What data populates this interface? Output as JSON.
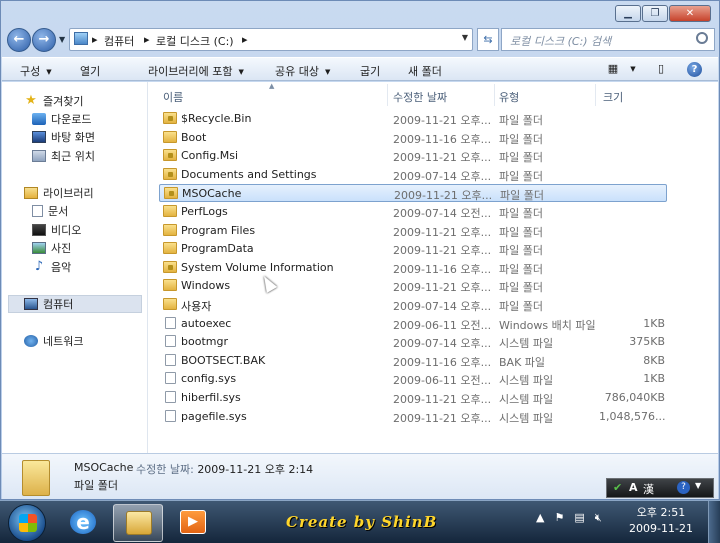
{
  "address": {
    "crumbs": [
      "컴퓨터",
      "로컬 디스크 (C:)"
    ],
    "search_placeholder": "로컬 디스크 (C:) 검색"
  },
  "toolbar": {
    "organize": "구성",
    "open": "열기",
    "include_library": "라이브러리에 포함",
    "share_with": "공유 대상",
    "burn": "굽기",
    "new_folder": "새 폴더"
  },
  "sidebar": {
    "favorites": "즐겨찾기",
    "downloads": "다운로드",
    "desktop": "바탕 화면",
    "recent": "최근 위치",
    "libraries": "라이브러리",
    "documents": "문서",
    "videos": "비디오",
    "pictures": "사진",
    "music": "음악",
    "computer": "컴퓨터",
    "network": "네트워크"
  },
  "columns": {
    "name": "이름",
    "date": "수정한 날짜",
    "type": "유형",
    "size": "크기"
  },
  "files": [
    {
      "name": "$Recycle.Bin",
      "date": "2009-11-21 오후...",
      "type": "파일 폴더",
      "size": "",
      "icon": "locked-folder-icon"
    },
    {
      "name": "Boot",
      "date": "2009-11-16 오후...",
      "type": "파일 폴더",
      "size": "",
      "icon": "folder-icon"
    },
    {
      "name": "Config.Msi",
      "date": "2009-11-21 오후...",
      "type": "파일 폴더",
      "size": "",
      "icon": "locked-folder-icon"
    },
    {
      "name": "Documents and Settings",
      "date": "2009-07-14 오후...",
      "type": "파일 폴더",
      "size": "",
      "icon": "locked-folder-icon"
    },
    {
      "name": "MSOCache",
      "date": "2009-11-21 오후...",
      "type": "파일 폴더",
      "size": "",
      "icon": "locked-folder-icon"
    },
    {
      "name": "PerfLogs",
      "date": "2009-07-14 오전...",
      "type": "파일 폴더",
      "size": "",
      "icon": "folder-icon"
    },
    {
      "name": "Program Files",
      "date": "2009-11-21 오후...",
      "type": "파일 폴더",
      "size": "",
      "icon": "folder-icon"
    },
    {
      "name": "ProgramData",
      "date": "2009-11-21 오후...",
      "type": "파일 폴더",
      "size": "",
      "icon": "folder-icon"
    },
    {
      "name": "System Volume Information",
      "date": "2009-11-16 오후...",
      "type": "파일 폴더",
      "size": "",
      "icon": "locked-folder-icon"
    },
    {
      "name": "Windows",
      "date": "2009-11-21 오후...",
      "type": "파일 폴더",
      "size": "",
      "icon": "folder-icon"
    },
    {
      "name": "사용자",
      "date": "2009-07-14 오후...",
      "type": "파일 폴더",
      "size": "",
      "icon": "folder-icon"
    },
    {
      "name": "autoexec",
      "date": "2009-06-11 오전...",
      "type": "Windows 배치 파일",
      "size": "1KB",
      "icon": "file-icon"
    },
    {
      "name": "bootmgr",
      "date": "2009-07-14 오후...",
      "type": "시스템 파일",
      "size": "375KB",
      "icon": "file-icon"
    },
    {
      "name": "BOOTSECT.BAK",
      "date": "2009-11-16 오후...",
      "type": "BAK 파일",
      "size": "8KB",
      "icon": "file-icon"
    },
    {
      "name": "config.sys",
      "date": "2009-06-11 오전...",
      "type": "시스템 파일",
      "size": "1KB",
      "icon": "file-icon"
    },
    {
      "name": "hiberfil.sys",
      "date": "2009-11-21 오후...",
      "type": "시스템 파일",
      "size": "786,040KB",
      "icon": "file-icon"
    },
    {
      "name": "pagefile.sys",
      "date": "2009-11-21 오후...",
      "type": "시스템 파일",
      "size": "1,048,576...",
      "icon": "file-icon"
    }
  ],
  "selected_index": 4,
  "details": {
    "name": "MSOCache",
    "date_label": "수정한 날짜:",
    "date_value": "2009-11-21 오후 2:14",
    "type": "파일 폴더"
  },
  "taskbar": {
    "brand_text": "Create by ShinB",
    "time": "오후 2:51",
    "date": "2009-11-21",
    "ime_mode": "A",
    "ime_hanja": "漢"
  },
  "colors": {
    "selection_border": "#7da2ce",
    "taskbar": "#1c3048",
    "brand_text": "#ffd62b"
  }
}
